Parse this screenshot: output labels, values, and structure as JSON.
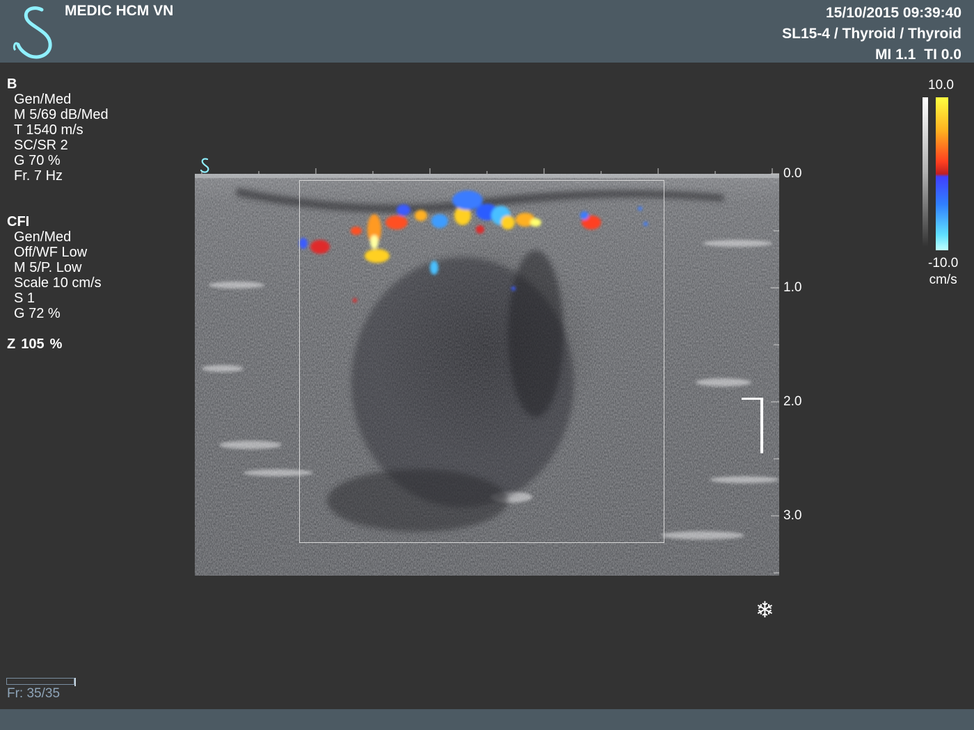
{
  "header": {
    "brand": "MEDIC HCM VN",
    "datetime": "15/10/2015 09:39:40",
    "probe_preset": "SL15-4 / Thyroid / Thyroid",
    "mi": "MI 1.1",
    "ti": "TI 0.0"
  },
  "b_mode": {
    "title": "B",
    "params": [
      "Gen/Med",
      "M 5/69 dB/Med",
      "T 1540 m/s",
      "SC/SR 2",
      "G 70 %",
      "Fr. 7 Hz"
    ]
  },
  "cfi_mode": {
    "title": "CFI",
    "params": [
      "Gen/Med",
      "Off/WF Low",
      "M 5/P. Low",
      "Scale 10 cm/s",
      "S 1",
      "G 72 %"
    ]
  },
  "zoom": {
    "label": "Z",
    "value": "105",
    "unit": "%"
  },
  "depth_scale": {
    "labels": [
      "0.0",
      "1.0",
      "2.0",
      "3.0"
    ]
  },
  "color_scale": {
    "max": "10.0",
    "min": "-10.0",
    "unit": "cm/s"
  },
  "cine": {
    "frame_counter": "Fr: 35/35",
    "progress": 1.0
  },
  "icons": {
    "logo": "medic-logo-icon",
    "freeze": "snowflake-icon",
    "probe": "probe-orientation-icon"
  },
  "colors": {
    "background": "#333333",
    "bar": "#4c5a63",
    "logo": "#8ff0ff",
    "frame_counter": "#8ea4b8"
  }
}
